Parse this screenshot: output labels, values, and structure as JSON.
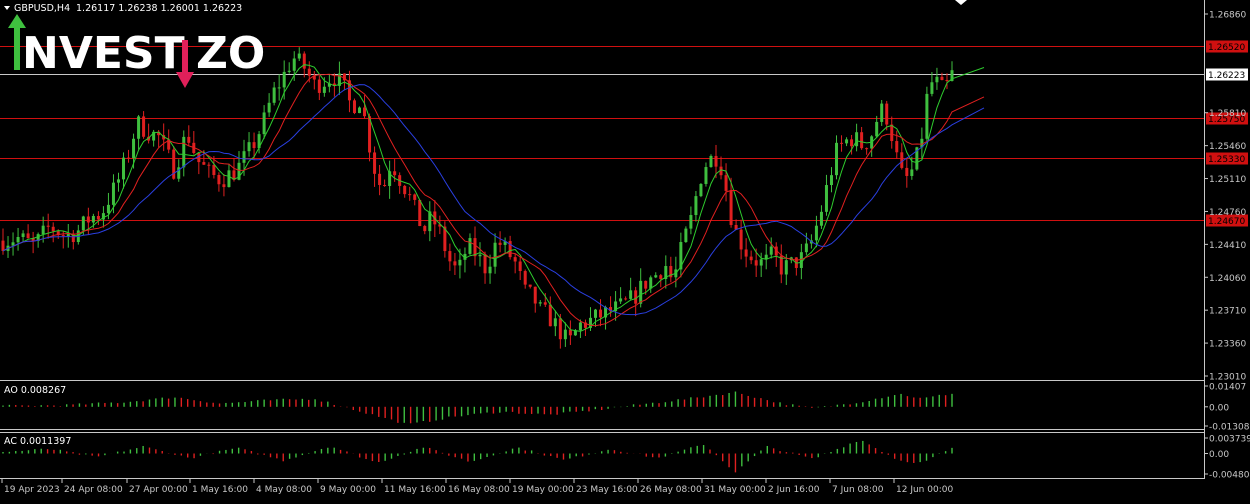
{
  "header": {
    "symbol": "GBPUSD,H4",
    "ohlc": "1.26117 1.26238 1.26001 1.26223"
  },
  "logo": {
    "text": "INVESTIZO"
  },
  "colors": {
    "background": "#000000",
    "bull": "#3fbf3f",
    "bear": "#e02020",
    "ma_fast": "#2ecc2e",
    "ma_mid": "#e02020",
    "ma_slow": "#2a3fe0",
    "level": "#d01010",
    "axis": "#c8c8c8",
    "logo_white": "#ffffff",
    "logo_green": "#3fc03f",
    "logo_red": "#e0205a"
  },
  "chart_data": [
    {
      "type": "candlestick",
      "pane": "main",
      "symbol": "GBPUSD",
      "timeframe": "H4",
      "ylim": [
        1.2301,
        1.2686
      ],
      "y_ticks": [
        "1.26860",
        "1.25810",
        "1.25460",
        "1.25110",
        "1.24760",
        "1.24410",
        "1.24060",
        "1.23710",
        "1.23360",
        "1.23010"
      ],
      "x_ticks": [
        "19 Apr 2023",
        "24 Apr 08:00",
        "27 Apr 00:00",
        "1 May 16:00",
        "4 May 08:00",
        "9 May 00:00",
        "11 May 16:00",
        "16 May 08:00",
        "19 May 00:00",
        "23 May 16:00",
        "26 May 08:00",
        "31 May 00:00",
        "2 Jun 16:00",
        "7 Jun 08:00",
        "12 Jun 00:00"
      ],
      "levels": [
        {
          "label": "1.26520",
          "value": 1.2652
        },
        {
          "label": "1.25750",
          "value": 1.2575
        },
        {
          "label": "1.25330",
          "value": 1.2533
        },
        {
          "label": "1.24670",
          "value": 1.2467
        }
      ],
      "current_price": {
        "label": "1.26223",
        "value": 1.26223
      },
      "close_path": [
        [
          0,
          1.2445
        ],
        [
          10,
          1.2448
        ],
        [
          20,
          1.244
        ],
        [
          30,
          1.246
        ],
        [
          40,
          1.245
        ],
        [
          48,
          1.2455
        ],
        [
          56,
          1.247
        ],
        [
          63,
          1.2473
        ],
        [
          68,
          1.249
        ],
        [
          73,
          1.2505
        ],
        [
          80,
          1.2535
        ],
        [
          86,
          1.257
        ],
        [
          94,
          1.256
        ],
        [
          100,
          1.2555
        ],
        [
          110,
          1.252
        ],
        [
          118,
          1.256
        ],
        [
          125,
          1.253
        ],
        [
          133,
          1.2515
        ],
        [
          140,
          1.251
        ],
        [
          150,
          1.252
        ],
        [
          160,
          1.2545
        ],
        [
          167,
          1.257
        ],
        [
          173,
          1.26
        ],
        [
          180,
          1.262
        ],
        [
          186,
          1.264
        ],
        [
          193,
          1.263
        ],
        [
          200,
          1.261
        ],
        [
          206,
          1.2615
        ],
        [
          212,
          1.262
        ],
        [
          218,
          1.261
        ],
        [
          224,
          1.2585
        ],
        [
          228,
          1.26
        ],
        [
          232,
          1.2575
        ],
        [
          236,
          1.254
        ],
        [
          240,
          1.251
        ],
        [
          244,
          1.25
        ],
        [
          249,
          1.253
        ],
        [
          255,
          1.251
        ],
        [
          260,
          1.2495
        ],
        [
          266,
          1.247
        ],
        [
          270,
          1.2455
        ],
        [
          275,
          1.247
        ],
        [
          280,
          1.2455
        ],
        [
          286,
          1.2425
        ],
        [
          292,
          1.241
        ],
        [
          298,
          1.244
        ],
        [
          304,
          1.243
        ],
        [
          310,
          1.2415
        ],
        [
          317,
          1.2445
        ],
        [
          323,
          1.2435
        ],
        [
          329,
          1.242
        ],
        [
          335,
          1.239
        ],
        [
          340,
          1.2385
        ],
        [
          345,
          1.237
        ],
        [
          350,
          1.2365
        ],
        [
          357,
          1.235
        ],
        [
          363,
          1.2335
        ],
        [
          370,
          1.2355
        ],
        [
          377,
          1.236
        ],
        [
          383,
          1.2365
        ],
        [
          390,
          1.237
        ],
        [
          397,
          1.2375
        ],
        [
          405,
          1.2385
        ],
        [
          412,
          1.24
        ],
        [
          420,
          1.241
        ],
        [
          425,
          1.242
        ],
        [
          430,
          1.24
        ],
        [
          436,
          1.244
        ],
        [
          442,
          1.247
        ],
        [
          447,
          1.251
        ],
        [
          452,
          1.253
        ],
        [
          458,
          1.2535
        ],
        [
          462,
          1.252
        ],
        [
          466,
          1.248
        ],
        [
          470,
          1.2455
        ],
        [
          476,
          1.2435
        ],
        [
          482,
          1.2425
        ],
        [
          488,
          1.242
        ],
        [
          494,
          1.243
        ],
        [
          500,
          1.2415
        ],
        [
          506,
          1.242
        ],
        [
          512,
          1.2425
        ],
        [
          518,
          1.244
        ],
        [
          524,
          1.247
        ],
        [
          530,
          1.251
        ],
        [
          535,
          1.254
        ],
        [
          540,
          1.255
        ],
        [
          546,
          1.2555
        ],
        [
          552,
          1.2545
        ],
        [
          558,
          1.256
        ],
        [
          563,
          1.2585
        ],
        [
          568,
          1.2575
        ],
        [
          572,
          1.2545
        ],
        [
          576,
          1.2515
        ],
        [
          581,
          1.251
        ],
        [
          586,
          1.253
        ],
        [
          590,
          1.256
        ],
        [
          594,
          1.261
        ],
        [
          598,
          1.2615
        ],
        [
          603,
          1.2605
        ],
        [
          606,
          1.261
        ],
        [
          609,
          1.2622
        ]
      ],
      "x_domain": [
        0,
        609
      ]
    },
    {
      "type": "histogram",
      "pane": "sub1",
      "title": "AO 0.008267",
      "ylim": [
        -0.013086,
        0.01407
      ],
      "y_ticks": [
        "0.01407",
        "0.00",
        "-0.013086"
      ],
      "shape": [
        [
          0,
          0.0005
        ],
        [
          40,
          0.001
        ],
        [
          80,
          0.003
        ],
        [
          110,
          0.006
        ],
        [
          140,
          0.002
        ],
        [
          170,
          0.004
        ],
        [
          200,
          0.005
        ],
        [
          230,
          -0.003
        ],
        [
          260,
          -0.011
        ],
        [
          290,
          -0.006
        ],
        [
          320,
          -0.003
        ],
        [
          350,
          -0.005
        ],
        [
          380,
          -0.002
        ],
        [
          410,
          0.0015
        ],
        [
          440,
          0.005
        ],
        [
          470,
          0.009
        ],
        [
          500,
          0.002
        ],
        [
          520,
          -0.001
        ],
        [
          550,
          0.003
        ],
        [
          575,
          0.008
        ],
        [
          590,
          0.005
        ],
        [
          609,
          0.0083
        ]
      ]
    },
    {
      "type": "histogram",
      "pane": "sub2",
      "title": "AC 0.0011397",
      "ylim": [
        -0.004804,
        0.003739
      ],
      "y_ticks": [
        "0.0037393",
        "0.00",
        "-0.004804"
      ],
      "shape": [
        [
          0,
          0.0003
        ],
        [
          30,
          0.001
        ],
        [
          60,
          -0.0008
        ],
        [
          90,
          0.0015
        ],
        [
          120,
          -0.001
        ],
        [
          150,
          0.0012
        ],
        [
          180,
          -0.0015
        ],
        [
          210,
          0.0016
        ],
        [
          240,
          -0.002
        ],
        [
          270,
          0.0014
        ],
        [
          300,
          -0.0018
        ],
        [
          330,
          0.0013
        ],
        [
          360,
          -0.0014
        ],
        [
          390,
          0.001
        ],
        [
          420,
          -0.001
        ],
        [
          450,
          0.002
        ],
        [
          470,
          -0.004
        ],
        [
          490,
          0.0015
        ],
        [
          520,
          -0.0012
        ],
        [
          550,
          0.003
        ],
        [
          575,
          -0.0015
        ],
        [
          590,
          -0.002
        ],
        [
          609,
          0.0011
        ]
      ]
    }
  ]
}
